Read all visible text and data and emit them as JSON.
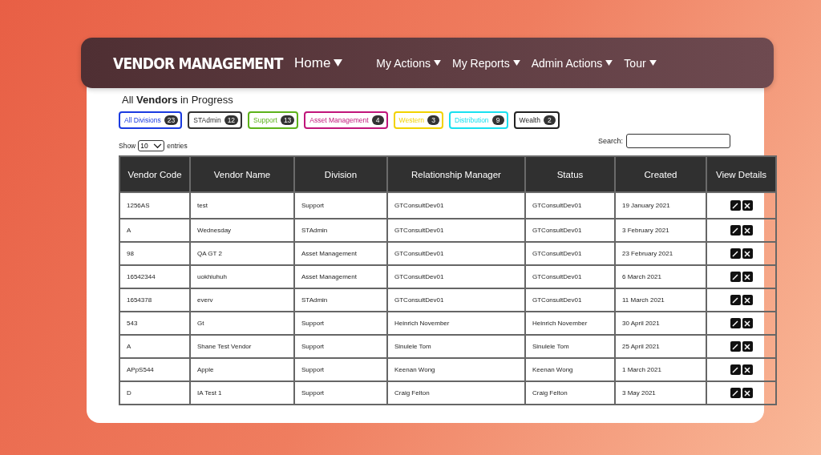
{
  "navbar": {
    "brand": "VENDOR MANAGEMENT",
    "menus": [
      {
        "label": "Home",
        "kind": "main"
      },
      {
        "label": "My Actions",
        "kind": "sub"
      },
      {
        "label": "My Reports",
        "kind": "sub"
      },
      {
        "label": "Admin Actions",
        "kind": "sub"
      },
      {
        "label": "Tour",
        "kind": "sub"
      }
    ]
  },
  "page": {
    "title": "All **Vendors** in Progress"
  },
  "filters": [
    {
      "label": "All Divisions",
      "count": "23",
      "color": "#1a3be0"
    },
    {
      "label": "STAdmin",
      "count": "12",
      "color": "#333333"
    },
    {
      "label": "Support",
      "count": "13",
      "color": "#5cb21a"
    },
    {
      "label": "Asset Management",
      "count": "4",
      "color": "#c0157a"
    },
    {
      "label": "Western",
      "count": "3",
      "color": "#f2d200"
    },
    {
      "label": "Distribution",
      "count": "9",
      "color": "#19e0f0"
    },
    {
      "label": "Wealth",
      "count": "2",
      "color": "#222222"
    }
  ],
  "entries": {
    "show_label": "Show",
    "value": "10",
    "suffix": "entries"
  },
  "search": {
    "label": "Search:"
  },
  "table": {
    "columns": [
      "Vendor Code",
      "Vendor Name",
      "Division",
      "Relationship Manager",
      "Status",
      "Created",
      "View Details"
    ],
    "rows": [
      [
        "1256AS",
        "test",
        "Support",
        "GTConsultDev01",
        "GTConsultDev01",
        "19 January 2021"
      ],
      [
        "A",
        "Wednesday",
        "STAdmin",
        "GTConsultDev01",
        "GTConsultDev01",
        "3 February 2021"
      ],
      [
        "98",
        "QA GT 2",
        "Asset Management",
        "GTConsultDev01",
        "GTConsultDev01",
        "23 February 2021"
      ],
      [
        "16542344",
        "uokhiuhuh",
        "Asset Management",
        "GTConsultDev01",
        "GTConsultDev01",
        "6 March 2021"
      ],
      [
        "1654378",
        "everv",
        "STAdmin",
        "GTConsultDev01",
        "GTConsultDev01",
        "11 March 2021"
      ],
      [
        "543",
        "Gt",
        "Support",
        "Heinrich November",
        "Heinrich November",
        "30 April 2021"
      ],
      [
        "A",
        "Shane Test Vendor",
        "Support",
        "Sinulele Tom",
        "Sinulele Tom",
        "25 April 2021"
      ],
      [
        "APpS544",
        "Apple",
        "Support",
        "Keenan Wong",
        "Keenan Wong",
        "1 March 2021"
      ],
      [
        "D",
        "IA Test 1",
        "Support",
        "Craig Felton",
        "Craig Felton",
        "3 May 2021"
      ]
    ]
  }
}
